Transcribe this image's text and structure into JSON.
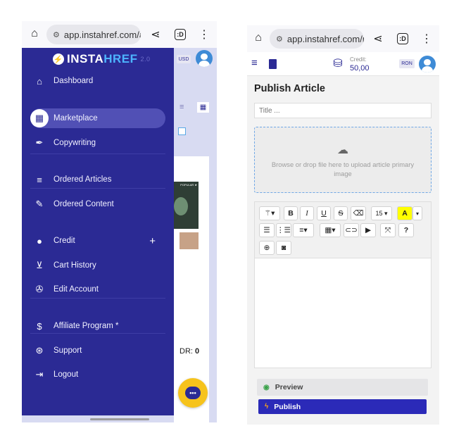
{
  "browser": {
    "url_left": "app.instahref.com/a",
    "url_right": "app.instahref.com/m",
    "tab_count_left": ":D",
    "tab_count_right": ":D"
  },
  "drawer": {
    "logo_insta": "INSTA",
    "logo_href": "HREF",
    "logo_version": "2.0",
    "items": [
      {
        "label": "Dashboard",
        "icon": "home-icon",
        "glyph": "⌂"
      },
      {
        "label": "Marketplace",
        "icon": "grid-icon",
        "glyph": "▦",
        "active": true
      },
      {
        "label": "Copywriting",
        "icon": "pen-icon",
        "glyph": "✒"
      },
      {
        "label": "Ordered Articles",
        "icon": "list-icon",
        "glyph": "≡"
      },
      {
        "label": "Ordered Content",
        "icon": "edit-icon",
        "glyph": "✎"
      },
      {
        "label": "Credit",
        "icon": "piggy-bank-icon",
        "glyph": "●"
      },
      {
        "label": "Cart History",
        "icon": "cart-icon",
        "glyph": "⊻"
      },
      {
        "label": "Edit Account",
        "icon": "user-edit-icon",
        "glyph": "✇"
      },
      {
        "label": "Affiliate Program *",
        "icon": "hand-dollar-icon",
        "glyph": "$"
      },
      {
        "label": "Support",
        "icon": "lifebuoy-icon",
        "glyph": "⊛"
      },
      {
        "label": "Logout",
        "icon": "logout-icon",
        "glyph": "⇥"
      }
    ],
    "plus": "+"
  },
  "background": {
    "currency": "USD",
    "dr_label": "DR:",
    "dr_value": "0",
    "thumb_label": "POPULAR ★"
  },
  "publish": {
    "currency": "RON",
    "credit_label": "Credit:",
    "credit_value": "50,00",
    "page_title": "Publish Article",
    "title_placeholder": "Title ...",
    "dropzone_text": "Browse or drop file here to upload article primary image",
    "toolbar": {
      "bold": "B",
      "italic": "I",
      "underline": "U",
      "strike": "S",
      "font_size": "15 ▾",
      "color": "A",
      "help": "?"
    },
    "preview_label": "Preview",
    "publish_label": "Publish"
  },
  "colors": {
    "brand": "#2b2a94",
    "accent": "#4db4ff",
    "chat": "#f6c31c",
    "publish": "#2b2ab8"
  }
}
